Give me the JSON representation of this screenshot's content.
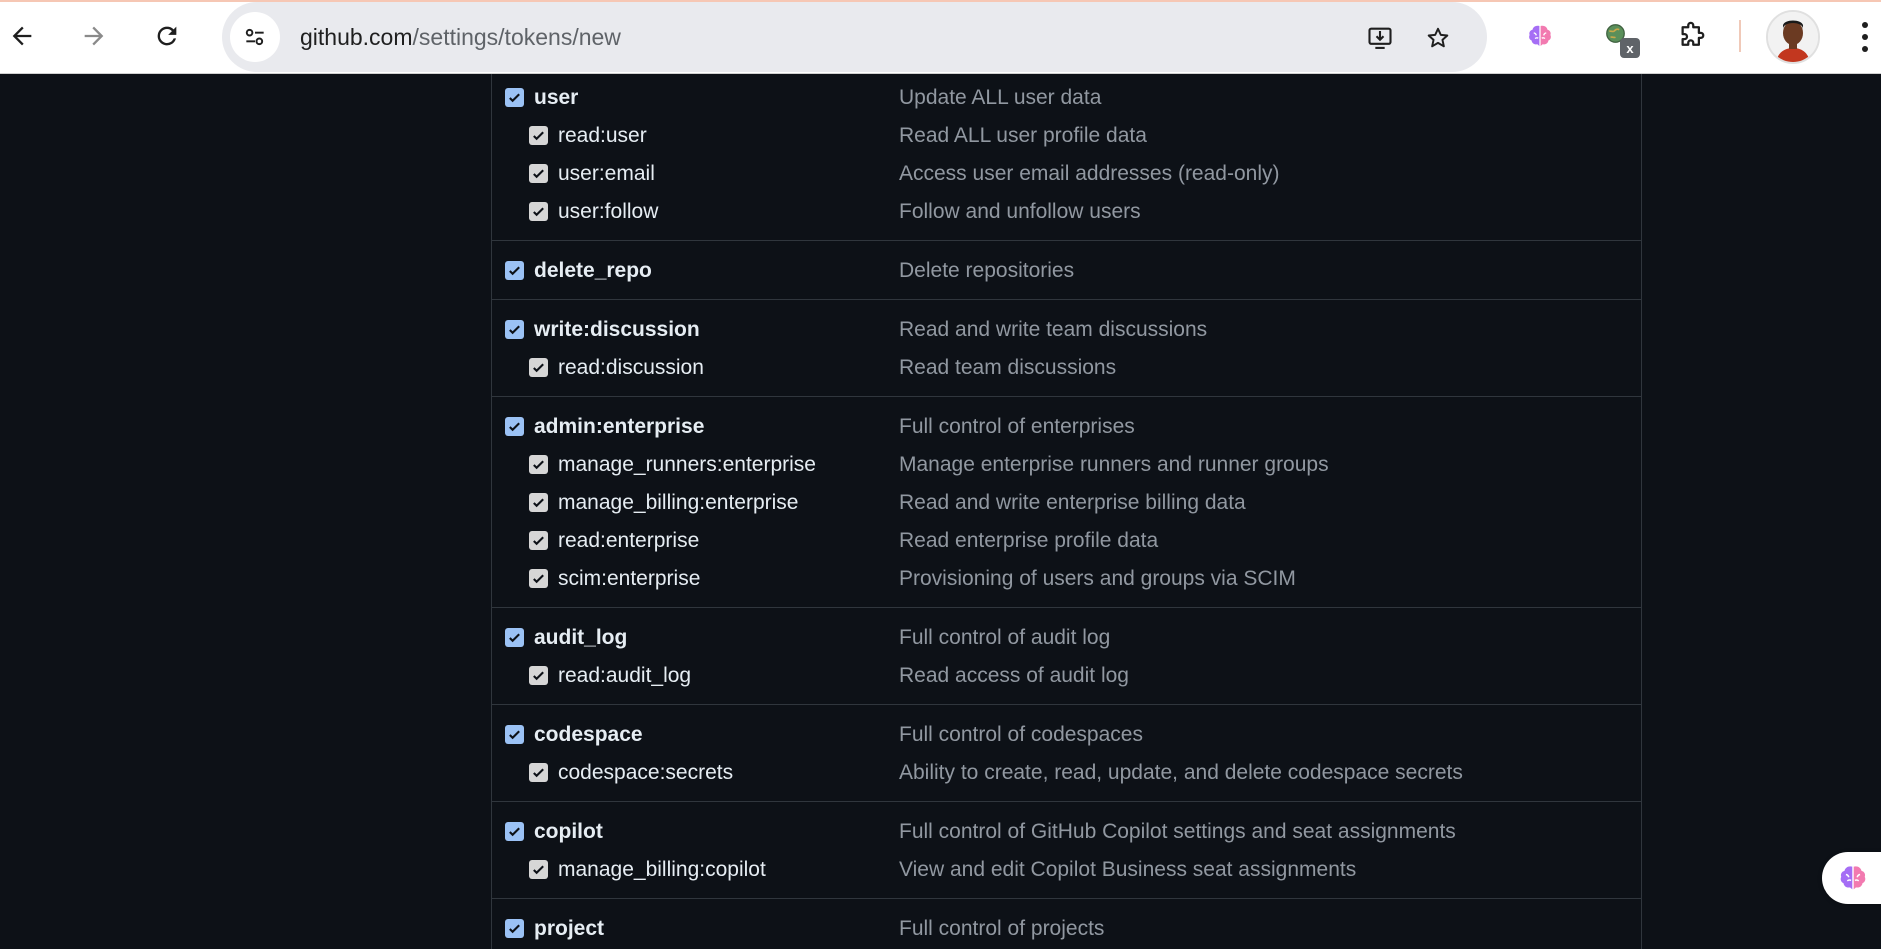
{
  "browser": {
    "url_host": "github.com",
    "url_path": "/settings/tokens/new",
    "extension_badge": "x"
  },
  "scope_groups": [
    {
      "name": "user",
      "description": "Update ALL user data",
      "children": [
        {
          "name": "read:user",
          "description": "Read ALL user profile data"
        },
        {
          "name": "user:email",
          "description": "Access user email addresses (read-only)"
        },
        {
          "name": "user:follow",
          "description": "Follow and unfollow users"
        }
      ]
    },
    {
      "name": "delete_repo",
      "description": "Delete repositories",
      "children": []
    },
    {
      "name": "write:discussion",
      "description": "Read and write team discussions",
      "children": [
        {
          "name": "read:discussion",
          "description": "Read team discussions"
        }
      ]
    },
    {
      "name": "admin:enterprise",
      "description": "Full control of enterprises",
      "children": [
        {
          "name": "manage_runners:enterprise",
          "description": "Manage enterprise runners and runner groups"
        },
        {
          "name": "manage_billing:enterprise",
          "description": "Read and write enterprise billing data"
        },
        {
          "name": "read:enterprise",
          "description": "Read enterprise profile data"
        },
        {
          "name": "scim:enterprise",
          "description": "Provisioning of users and groups via SCIM"
        }
      ]
    },
    {
      "name": "audit_log",
      "description": "Full control of audit log",
      "children": [
        {
          "name": "read:audit_log",
          "description": "Read access of audit log"
        }
      ]
    },
    {
      "name": "codespace",
      "description": "Full control of codespaces",
      "children": [
        {
          "name": "codespace:secrets",
          "description": "Ability to create, read, update, and delete codespace secrets"
        }
      ]
    },
    {
      "name": "copilot",
      "description": "Full control of GitHub Copilot settings and seat assignments",
      "children": [
        {
          "name": "manage_billing:copilot",
          "description": "View and edit Copilot Business seat assignments"
        }
      ]
    },
    {
      "name": "project",
      "description": "Full control of projects",
      "children": []
    }
  ],
  "colors": {
    "background": "#0d1117",
    "border": "#30363d",
    "text": "#e6edf3",
    "muted": "#9198a1",
    "checkbox_checked": "#9bc2f5",
    "checkbox_child": "#d6d6d6"
  }
}
